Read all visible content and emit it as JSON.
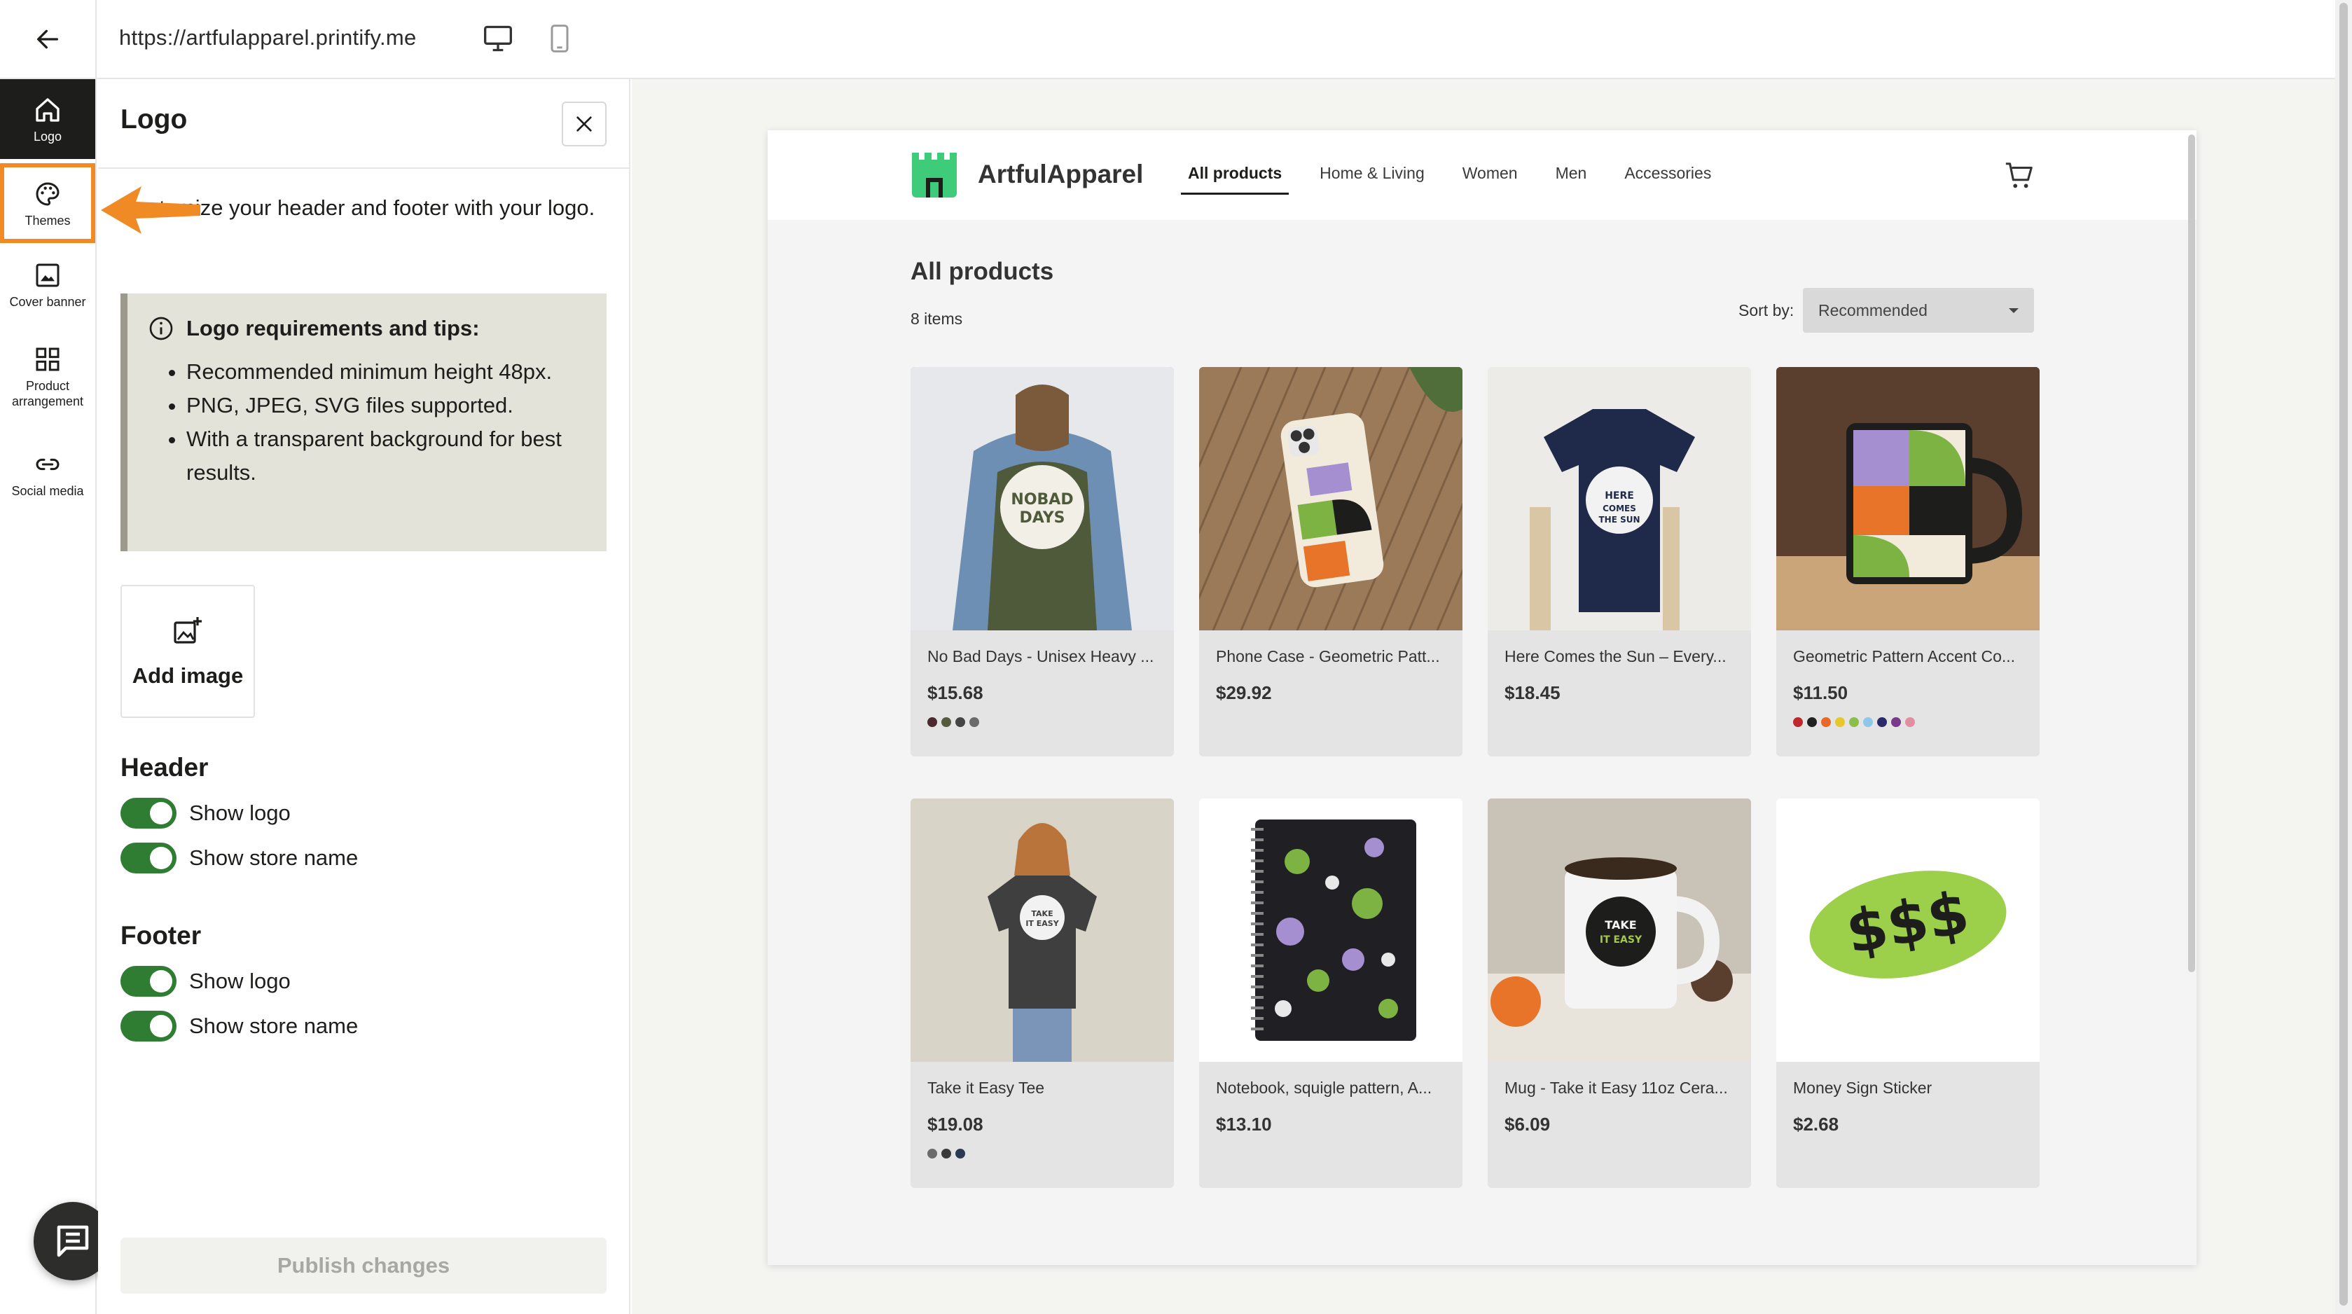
{
  "browser": {
    "url": "https://artfulapparel.printify.me"
  },
  "rail": {
    "items": [
      {
        "label": "Logo"
      },
      {
        "label": "Themes"
      },
      {
        "label": "Cover banner"
      },
      {
        "label": "Product arrangement"
      },
      {
        "label": "Social media"
      }
    ]
  },
  "panel": {
    "title": "Logo",
    "description": "Customize your header and footer with your logo.",
    "tips": {
      "title": "Logo requirements and tips:",
      "items": [
        "Recommended minimum height 48px.",
        "PNG, JPEG, SVG files supported.",
        "With a transparent background for best results."
      ]
    },
    "add_image_label": "Add image",
    "header": {
      "title": "Header",
      "show_logo": "Show logo",
      "show_store_name": "Show store name"
    },
    "footer": {
      "title": "Footer",
      "show_logo": "Show logo",
      "show_store_name": "Show store name"
    },
    "publish_label": "Publish changes"
  },
  "store": {
    "name": "ArtfulApparel",
    "nav": [
      "All products",
      "Home & Living",
      "Women",
      "Men",
      "Accessories"
    ],
    "page_title": "All products",
    "items_count": "8 items",
    "sort_label": "Sort by:",
    "sort_value": "Recommended",
    "products": [
      {
        "title": "No Bad Days - Unisex Heavy ...",
        "price": "$15.68",
        "swatches": [
          "#4a2a2e",
          "#555b3c",
          "#444444",
          "#6a6a6a"
        ],
        "bg": "#8a98a8",
        "art": "NOBAD DAYS"
      },
      {
        "title": "Phone Case - Geometric Patt...",
        "price": "$29.92",
        "swatches": [],
        "bg": "#9a7a58",
        "art": ""
      },
      {
        "title": "Here Comes the Sun – Every...",
        "price": "$18.45",
        "swatches": [],
        "bg": "#e8e8e6",
        "art": "HERE COMES THE SUN"
      },
      {
        "title": "Geometric Pattern Accent Co...",
        "price": "$11.50",
        "swatches": [
          "#c0272d",
          "#222222",
          "#e8682a",
          "#e6c82a",
          "#8bbf4a",
          "#8fc7e8",
          "#2a2a6a",
          "#7a3a8a",
          "#e08fa0"
        ],
        "bg": "#5a3f2e",
        "art": ""
      },
      {
        "title": "Take it Easy Tee",
        "price": "$19.08",
        "swatches": [
          "#6a6a6a",
          "#3a3a3a",
          "#2a3a55"
        ],
        "bg": "#d8d4c8",
        "art": "TAKE IT EASY"
      },
      {
        "title": "Notebook, squigle pattern, A...",
        "price": "$13.10",
        "swatches": [],
        "bg": "#ffffff",
        "art": ""
      },
      {
        "title": "Mug - Take it Easy 11oz Cera...",
        "price": "$6.09",
        "swatches": [],
        "bg": "#c9c2b6",
        "art": "TAKE IT EASY"
      },
      {
        "title": "Money Sign Sticker",
        "price": "$2.68",
        "swatches": [],
        "bg": "#ffffff",
        "art": "$$$"
      }
    ]
  }
}
